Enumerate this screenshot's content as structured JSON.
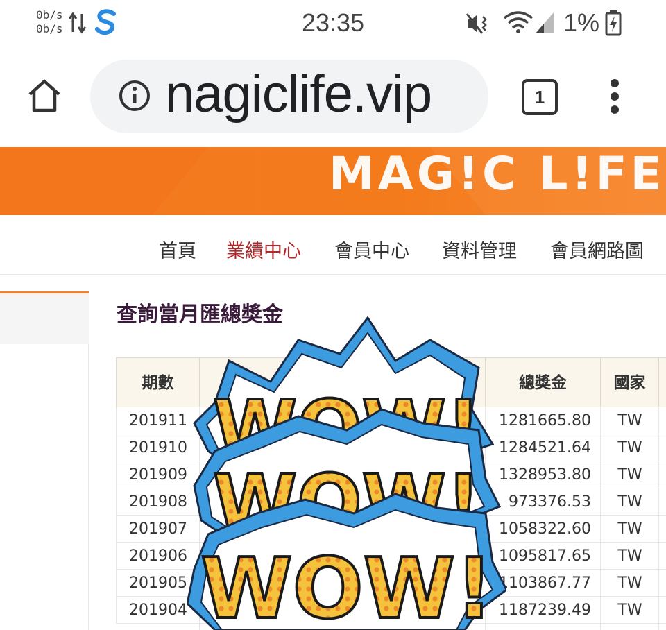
{
  "status_bar": {
    "net_up": "0b/s",
    "net_down": "0b/s",
    "time": "23:35",
    "battery": "1%"
  },
  "browser": {
    "url": "nagiclife.vip",
    "tab_count": "1"
  },
  "site": {
    "logo": "MAG!C L!FE",
    "nav": [
      "首頁",
      "業績中心",
      "會員中心",
      "資料管理",
      "會員網路圖"
    ],
    "active_nav": "業績中心"
  },
  "content": {
    "title": "查詢當月匯總獎金",
    "columns": [
      "期數",
      "總獎金",
      "國家"
    ],
    "rows": [
      {
        "period": "201911",
        "bonus": "1281665.80",
        "country": "TW"
      },
      {
        "period": "201910",
        "bonus": "1284521.64",
        "country": "TW"
      },
      {
        "period": "201909",
        "bonus": "1328953.80",
        "country": "TW"
      },
      {
        "period": "201908",
        "bonus": "973376.53",
        "country": "TW"
      },
      {
        "period": "201907",
        "bonus": "1058322.60",
        "country": "TW"
      },
      {
        "period": "201906",
        "bonus": "1095817.65",
        "country": "TW"
      },
      {
        "period": "201905",
        "bonus": "1103867.77",
        "country": "TW"
      },
      {
        "period": "201904",
        "bonus": "1187239.49",
        "country": "TW"
      }
    ]
  },
  "sticker": {
    "text": "WOW!"
  },
  "colors": {
    "brand_orange": "#f57a20",
    "nav_active": "#b3262a",
    "title": "#3a1a3a",
    "sticker_blue": "#3d9be0",
    "sticker_yellow": "#f5c23c",
    "sticker_dots": "#ec8a2a"
  }
}
